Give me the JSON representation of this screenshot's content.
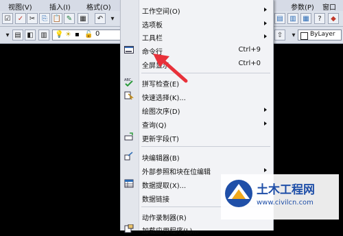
{
  "menubar": {
    "items": [
      "视图(V)",
      "插入(I)",
      "格式(O)",
      "参数(P)",
      "窗口"
    ]
  },
  "toolbar": {
    "layer_value": "0",
    "bylayer_label": "ByLayer"
  },
  "context_menu": {
    "items": [
      {
        "label": "工作空间(O)",
        "submenu": true
      },
      {
        "label": "选项板",
        "submenu": true
      },
      {
        "label": "工具栏",
        "submenu": true
      },
      {
        "label": "命令行",
        "shortcut": "Ctrl+9",
        "icon": "command-line-icon"
      },
      {
        "label": "全屏显示",
        "shortcut": "Ctrl+0"
      },
      {
        "label": "拼写检查(E)",
        "icon": "spell-check-icon"
      },
      {
        "label": "快速选择(K)...",
        "icon": "quick-select-icon"
      },
      {
        "label": "绘图次序(D)",
        "submenu": true
      },
      {
        "label": "查询(Q)",
        "submenu": true
      },
      {
        "label": "更新字段(T)",
        "icon": "update-field-icon"
      },
      {
        "label": "块编辑器(B)",
        "icon": "block-editor-icon"
      },
      {
        "label": "外部参照和块在位编辑",
        "submenu": true
      },
      {
        "label": "数据提取(X)...",
        "icon": "data-extraction-icon"
      },
      {
        "label": "数据链接"
      },
      {
        "label": "动作录制器(R)"
      },
      {
        "label": "加载应用程序(L)...",
        "icon": "load-app-icon"
      }
    ]
  },
  "watermark": {
    "title": "土木工程网",
    "url": "www.civilcn.com"
  },
  "colors": {
    "annotation_arrow": "#e8313a",
    "watermark_text": "#1f4fa8"
  }
}
